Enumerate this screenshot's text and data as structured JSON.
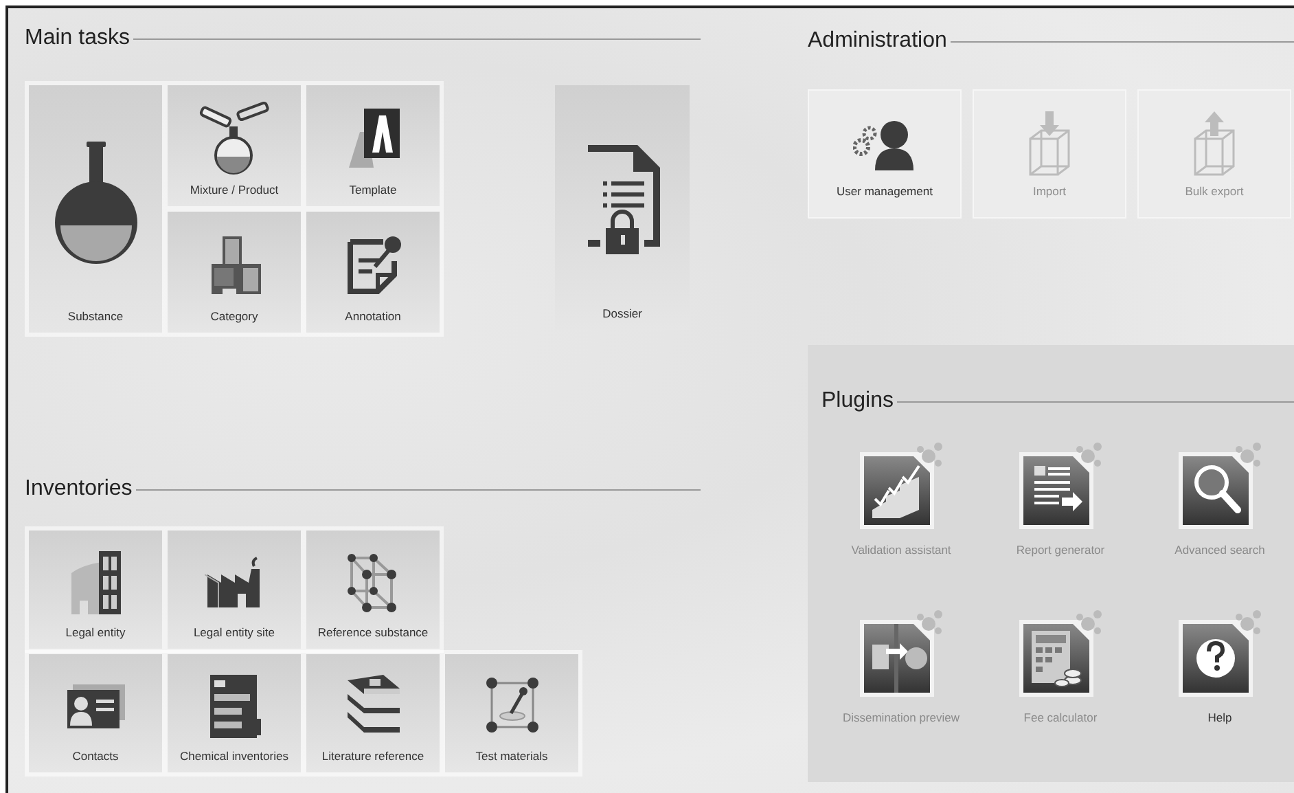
{
  "main_tasks": {
    "title": "Main tasks",
    "large_tile": {
      "label": "Substance"
    },
    "tiles": [
      {
        "label": "Mixture / Product"
      },
      {
        "label": "Template"
      },
      {
        "label": "Category"
      },
      {
        "label": "Annotation"
      }
    ],
    "dossier": {
      "label": "Dossier"
    }
  },
  "administration": {
    "title": "Administration",
    "tiles": [
      {
        "label": "User management",
        "disabled": false
      },
      {
        "label": "Import",
        "disabled": true
      },
      {
        "label": "Bulk export",
        "disabled": true
      }
    ]
  },
  "inventories": {
    "title": "Inventories",
    "rows": [
      {
        "tiles": [
          {
            "label": "Legal entity"
          },
          {
            "label": "Legal entity site"
          },
          {
            "label": "Reference substance"
          }
        ]
      },
      {
        "tiles": [
          {
            "label": "Contacts"
          },
          {
            "label": "Chemical inventories"
          },
          {
            "label": "Literature reference"
          },
          {
            "label": "Test materials"
          }
        ]
      }
    ]
  },
  "plugins": {
    "title": "Plugins",
    "tiles": [
      {
        "label": "Validation assistant",
        "disabled": true
      },
      {
        "label": "Report generator",
        "disabled": true
      },
      {
        "label": "Advanced search",
        "disabled": true
      },
      {
        "label": "Dissemination preview",
        "disabled": true
      },
      {
        "label": "Fee calculator",
        "disabled": true
      },
      {
        "label": "Help",
        "disabled": false
      }
    ]
  }
}
